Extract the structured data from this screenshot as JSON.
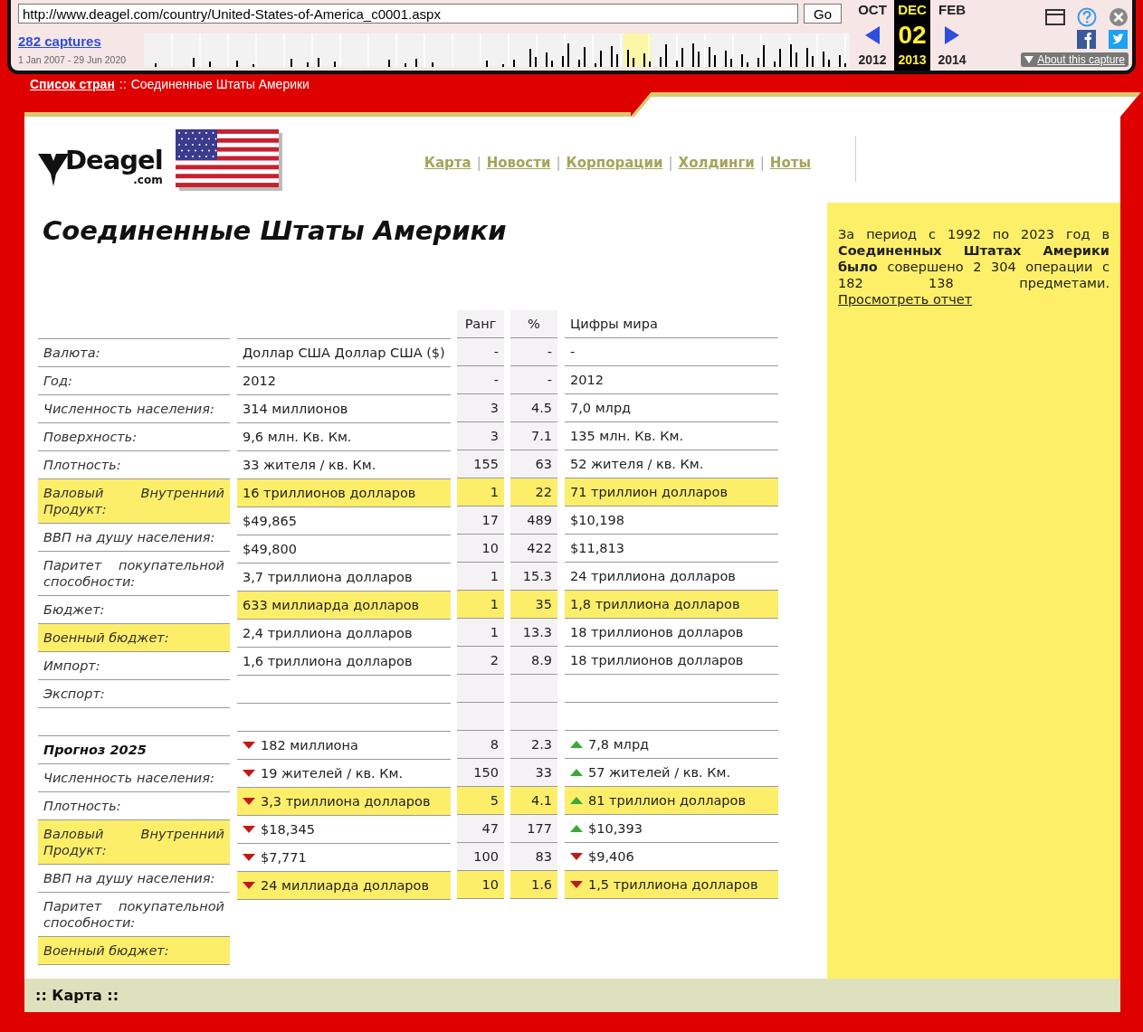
{
  "wayback": {
    "url": "http://www.deagel.com/country/United-States-of-America_c0001.aspx",
    "go": "Go",
    "captures": "282 captures",
    "range": "1 Jan 2007 - 29 Jun 2020",
    "months": [
      {
        "label": "OCT",
        "year": "2012",
        "selected": false
      },
      {
        "label": "DEC",
        "day": "02",
        "year": "2013",
        "selected": true
      },
      {
        "label": "FEB",
        "year": "2014",
        "selected": false
      }
    ],
    "about": "About this capture"
  },
  "breadcrumb": {
    "link": "Список стран",
    "separator": "::",
    "current": "Соединенные Штаты Америки"
  },
  "logo": {
    "text": "Deagel",
    "suffix": ".com"
  },
  "nav": [
    "Карта",
    "Новости",
    "Корпорации",
    "Холдинги",
    "Ноты"
  ],
  "nav_separator": "|",
  "title": "Соединенные Штаты Америки",
  "summary": {
    "text": "За период с 1992 по 2023 год в **Соединенных Штатах Америки было** совершено 2 304 операции с 182 138 предметами.",
    "link": "Просмотреть отчет"
  },
  "table": {
    "columns": [
      {
        "kind": "label",
        "cells": [
          {
            "text": "Валюта:",
            "highlighted": false,
            "heading": false
          },
          {
            "text": "Год:",
            "highlighted": false,
            "heading": false
          },
          {
            "text": "Численность населения:",
            "highlighted": false,
            "heading": false
          },
          {
            "text": "Поверхность:",
            "highlighted": false,
            "heading": false
          },
          {
            "text": "Плотность:",
            "highlighted": false,
            "heading": false
          },
          {
            "text": "Валовый Внутренний Продукт:",
            "highlighted": true,
            "heading": false
          },
          {
            "text": "ВВП на душу населения:",
            "highlighted": false,
            "heading": false
          },
          {
            "text": "Паритет покупательной способности:",
            "highlighted": false,
            "heading": false
          },
          {
            "text": "Бюджет:",
            "highlighted": false,
            "heading": false
          },
          {
            "text": "Военный бюджет:",
            "highlighted": true,
            "heading": false
          },
          {
            "text": "Импорт:",
            "highlighted": false,
            "heading": false
          },
          {
            "text": "Экспорт:",
            "highlighted": false,
            "heading": false
          },
          {
            "highlighted": false
          },
          {
            "text": "Прогноз 2025",
            "highlighted": false,
            "heading": true
          },
          {
            "text": "Численность населения:",
            "highlighted": false,
            "heading": false
          },
          {
            "text": "Плотность:",
            "highlighted": false,
            "heading": false
          },
          {
            "text": "Валовый Внутренний Продукт:",
            "highlighted": true,
            "heading": false
          },
          {
            "text": "ВВП на душу населения:",
            "highlighted": false,
            "heading": false
          },
          {
            "text": "Паритет покупательной способности:",
            "highlighted": false,
            "heading": false
          },
          {
            "text": "Военный бюджет:",
            "highlighted": true,
            "heading": false
          }
        ]
      },
      {
        "kind": "value",
        "cells": [
          {
            "text": "Доллар США Доллар США ($)",
            "highlighted": false
          },
          {
            "text": "2012",
            "highlighted": false
          },
          {
            "text": "314 миллионов",
            "highlighted": false
          },
          {
            "text": "9,6 млн. Кв. Км.",
            "highlighted": false
          },
          {
            "text": "33 жителя / кв. Км.",
            "highlighted": false
          },
          {
            "text": "16 триллионов долларов",
            "highlighted": true
          },
          {
            "text": "$49,865",
            "highlighted": false
          },
          {
            "text": "$49,800",
            "highlighted": false
          },
          {
            "text": "3,7 триллиона долларов",
            "highlighted": false
          },
          {
            "text": "633 миллиарда долларов",
            "highlighted": true
          },
          {
            "text": "2,4 триллиона долларов",
            "highlighted": false
          },
          {
            "text": "1,6 триллиона долларов",
            "highlighted": false
          },
          {
            "highlighted": false
          },
          {
            "highlighted": false
          },
          {
            "text": "182 миллиона",
            "highlighted": false,
            "rising": false
          },
          {
            "text": "19 жителей / кв. Км.",
            "highlighted": false,
            "rising": false
          },
          {
            "text": "3,3 триллиона долларов",
            "highlighted": true,
            "rising": false
          },
          {
            "text": "$18,345",
            "highlighted": false,
            "rising": false
          },
          {
            "text": "$7,771",
            "highlighted": false,
            "rising": false
          },
          {
            "text": "24 миллиарда долларов",
            "highlighted": true,
            "rising": false
          }
        ]
      },
      {
        "kind": "rank",
        "header": "Ранг",
        "cells": [
          {
            "text": "-",
            "highlighted": false
          },
          {
            "text": "-",
            "highlighted": false
          },
          {
            "text": "3",
            "highlighted": false
          },
          {
            "text": "3",
            "highlighted": false
          },
          {
            "text": "155",
            "highlighted": false
          },
          {
            "text": "1",
            "highlighted": true
          },
          {
            "text": "17",
            "highlighted": false
          },
          {
            "text": "10",
            "highlighted": false
          },
          {
            "text": "1",
            "highlighted": false
          },
          {
            "text": "1",
            "highlighted": true
          },
          {
            "text": "1",
            "highlighted": false
          },
          {
            "text": "2",
            "highlighted": false
          },
          {
            "highlighted": false
          },
          {
            "highlighted": false
          },
          {
            "text": "8",
            "highlighted": false
          },
          {
            "text": "150",
            "highlighted": false
          },
          {
            "text": "5",
            "highlighted": true
          },
          {
            "text": "47",
            "highlighted": false
          },
          {
            "text": "100",
            "highlighted": false
          },
          {
            "text": "10",
            "highlighted": true
          }
        ]
      },
      {
        "kind": "rank",
        "header": "%",
        "cells": [
          {
            "text": "-",
            "highlighted": false
          },
          {
            "text": "-",
            "highlighted": false
          },
          {
            "text": "4.5",
            "highlighted": false
          },
          {
            "text": "7.1",
            "highlighted": false
          },
          {
            "text": "63",
            "highlighted": false
          },
          {
            "text": "22",
            "highlighted": true
          },
          {
            "text": "489",
            "highlighted": false
          },
          {
            "text": "422",
            "highlighted": false
          },
          {
            "text": "15.3",
            "highlighted": false
          },
          {
            "text": "35",
            "highlighted": true
          },
          {
            "text": "13.3",
            "highlighted": false
          },
          {
            "text": "8.9",
            "highlighted": false
          },
          {
            "highlighted": false
          },
          {
            "highlighted": false
          },
          {
            "text": "2.3",
            "highlighted": false
          },
          {
            "text": "33",
            "highlighted": false
          },
          {
            "text": "4.1",
            "highlighted": true
          },
          {
            "text": "177",
            "highlighted": false
          },
          {
            "text": "83",
            "highlighted": false
          },
          {
            "text": "1.6",
            "highlighted": true
          }
        ]
      },
      {
        "kind": "world",
        "header": "Цифры мира",
        "cells": [
          {
            "text": "-",
            "highlighted": false
          },
          {
            "text": "2012",
            "highlighted": false
          },
          {
            "text": "7,0 млрд",
            "highlighted": false
          },
          {
            "text": "135 млн. Кв. Км.",
            "highlighted": false
          },
          {
            "text": "52 жителя / кв. Км.",
            "highlighted": false
          },
          {
            "text": "71 триллион долларов",
            "highlighted": true
          },
          {
            "text": "$10,198",
            "highlighted": false
          },
          {
            "text": "$11,813",
            "highlighted": false
          },
          {
            "text": "24 триллиона долларов",
            "highlighted": false
          },
          {
            "text": "1,8 триллиона долларов",
            "highlighted": true
          },
          {
            "text": "18 триллионов долларов",
            "highlighted": false
          },
          {
            "text": "18 триллионов долларов",
            "highlighted": false
          },
          {
            "highlighted": false
          },
          {
            "highlighted": false
          },
          {
            "text": "7,8 млрд",
            "highlighted": false,
            "rising": true
          },
          {
            "text": "57 жителей / кв. Км.",
            "highlighted": false,
            "rising": true
          },
          {
            "text": "81 триллион долларов",
            "highlighted": true,
            "rising": true
          },
          {
            "text": "$10,393",
            "highlighted": false,
            "rising": true
          },
          {
            "text": "$9,406",
            "highlighted": false,
            "rising": false
          },
          {
            "text": "1,5 триллиона долларов",
            "highlighted": true,
            "rising": false
          }
        ]
      }
    ]
  },
  "footer": ":: Карта ::"
}
